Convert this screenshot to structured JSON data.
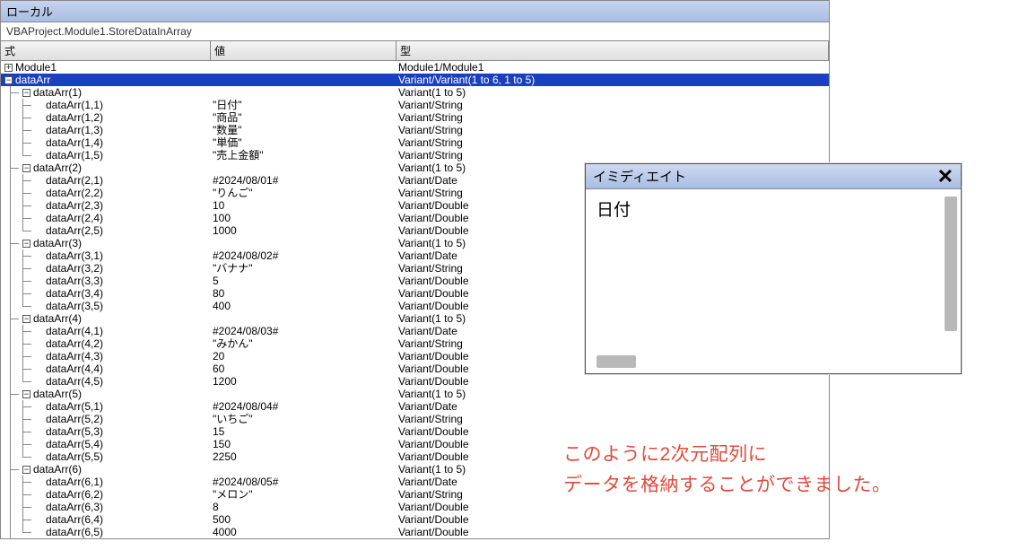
{
  "locals": {
    "title": "ローカル",
    "scope": "VBAProject.Module1.StoreDataInArray",
    "headers": {
      "expr": "式",
      "value": "値",
      "type": "型"
    },
    "rows": [
      {
        "depth": 0,
        "icon": "plus",
        "expr": "Module1",
        "value": "",
        "type": "Module1/Module1",
        "selected": false
      },
      {
        "depth": 0,
        "icon": "minus",
        "expr": "dataArr",
        "value": "",
        "type": "Variant/Variant(1 to 6, 1 to 5)",
        "selected": true
      },
      {
        "depth": 1,
        "icon": "minus",
        "expr": "dataArr(1)",
        "value": "",
        "type": "Variant(1 to 5)"
      },
      {
        "depth": 2,
        "icon": "",
        "expr": "dataArr(1,1)",
        "value": "\"日付\"",
        "type": "Variant/String",
        "mid": true
      },
      {
        "depth": 2,
        "icon": "",
        "expr": "dataArr(1,2)",
        "value": "\"商品\"",
        "type": "Variant/String",
        "mid": true
      },
      {
        "depth": 2,
        "icon": "",
        "expr": "dataArr(1,3)",
        "value": "\"数量\"",
        "type": "Variant/String",
        "mid": true
      },
      {
        "depth": 2,
        "icon": "",
        "expr": "dataArr(1,4)",
        "value": "\"単価\"",
        "type": "Variant/String",
        "mid": true
      },
      {
        "depth": 2,
        "icon": "",
        "expr": "dataArr(1,5)",
        "value": "\"売上金額\"",
        "type": "Variant/String"
      },
      {
        "depth": 1,
        "icon": "minus",
        "expr": "dataArr(2)",
        "value": "",
        "type": "Variant(1 to 5)"
      },
      {
        "depth": 2,
        "icon": "",
        "expr": "dataArr(2,1)",
        "value": "#2024/08/01#",
        "type": "Variant/Date",
        "mid": true
      },
      {
        "depth": 2,
        "icon": "",
        "expr": "dataArr(2,2)",
        "value": "\"りんご\"",
        "type": "Variant/String",
        "mid": true
      },
      {
        "depth": 2,
        "icon": "",
        "expr": "dataArr(2,3)",
        "value": "10",
        "type": "Variant/Double",
        "mid": true
      },
      {
        "depth": 2,
        "icon": "",
        "expr": "dataArr(2,4)",
        "value": "100",
        "type": "Variant/Double",
        "mid": true
      },
      {
        "depth": 2,
        "icon": "",
        "expr": "dataArr(2,5)",
        "value": "1000",
        "type": "Variant/Double"
      },
      {
        "depth": 1,
        "icon": "minus",
        "expr": "dataArr(3)",
        "value": "",
        "type": "Variant(1 to 5)"
      },
      {
        "depth": 2,
        "icon": "",
        "expr": "dataArr(3,1)",
        "value": "#2024/08/02#",
        "type": "Variant/Date",
        "mid": true
      },
      {
        "depth": 2,
        "icon": "",
        "expr": "dataArr(3,2)",
        "value": "\"バナナ\"",
        "type": "Variant/String",
        "mid": true
      },
      {
        "depth": 2,
        "icon": "",
        "expr": "dataArr(3,3)",
        "value": "5",
        "type": "Variant/Double",
        "mid": true
      },
      {
        "depth": 2,
        "icon": "",
        "expr": "dataArr(3,4)",
        "value": "80",
        "type": "Variant/Double",
        "mid": true
      },
      {
        "depth": 2,
        "icon": "",
        "expr": "dataArr(3,5)",
        "value": "400",
        "type": "Variant/Double"
      },
      {
        "depth": 1,
        "icon": "minus",
        "expr": "dataArr(4)",
        "value": "",
        "type": "Variant(1 to 5)"
      },
      {
        "depth": 2,
        "icon": "",
        "expr": "dataArr(4,1)",
        "value": "#2024/08/03#",
        "type": "Variant/Date",
        "mid": true
      },
      {
        "depth": 2,
        "icon": "",
        "expr": "dataArr(4,2)",
        "value": "\"みかん\"",
        "type": "Variant/String",
        "mid": true
      },
      {
        "depth": 2,
        "icon": "",
        "expr": "dataArr(4,3)",
        "value": "20",
        "type": "Variant/Double",
        "mid": true
      },
      {
        "depth": 2,
        "icon": "",
        "expr": "dataArr(4,4)",
        "value": "60",
        "type": "Variant/Double",
        "mid": true
      },
      {
        "depth": 2,
        "icon": "",
        "expr": "dataArr(4,5)",
        "value": "1200",
        "type": "Variant/Double"
      },
      {
        "depth": 1,
        "icon": "minus",
        "expr": "dataArr(5)",
        "value": "",
        "type": "Variant(1 to 5)"
      },
      {
        "depth": 2,
        "icon": "",
        "expr": "dataArr(5,1)",
        "value": "#2024/08/04#",
        "type": "Variant/Date",
        "mid": true
      },
      {
        "depth": 2,
        "icon": "",
        "expr": "dataArr(5,2)",
        "value": "\"いちご\"",
        "type": "Variant/String",
        "mid": true
      },
      {
        "depth": 2,
        "icon": "",
        "expr": "dataArr(5,3)",
        "value": "15",
        "type": "Variant/Double",
        "mid": true
      },
      {
        "depth": 2,
        "icon": "",
        "expr": "dataArr(5,4)",
        "value": "150",
        "type": "Variant/Double",
        "mid": true
      },
      {
        "depth": 2,
        "icon": "",
        "expr": "dataArr(5,5)",
        "value": "2250",
        "type": "Variant/Double"
      },
      {
        "depth": 1,
        "icon": "minus",
        "expr": "dataArr(6)",
        "value": "",
        "type": "Variant(1 to 5)"
      },
      {
        "depth": 2,
        "icon": "",
        "expr": "dataArr(6,1)",
        "value": "#2024/08/05#",
        "type": "Variant/Date",
        "mid": true
      },
      {
        "depth": 2,
        "icon": "",
        "expr": "dataArr(6,2)",
        "value": "\"メロン\"",
        "type": "Variant/String",
        "mid": true
      },
      {
        "depth": 2,
        "icon": "",
        "expr": "dataArr(6,3)",
        "value": "8",
        "type": "Variant/Double",
        "mid": true
      },
      {
        "depth": 2,
        "icon": "",
        "expr": "dataArr(6,4)",
        "value": "500",
        "type": "Variant/Double",
        "mid": true
      },
      {
        "depth": 2,
        "icon": "",
        "expr": "dataArr(6,5)",
        "value": "4000",
        "type": "Variant/Double"
      }
    ]
  },
  "immediate": {
    "title": "イミディエイト",
    "output": "日付"
  },
  "annotation": {
    "line1": "このように2次元配列に",
    "line2": "データを格納することができました。"
  }
}
